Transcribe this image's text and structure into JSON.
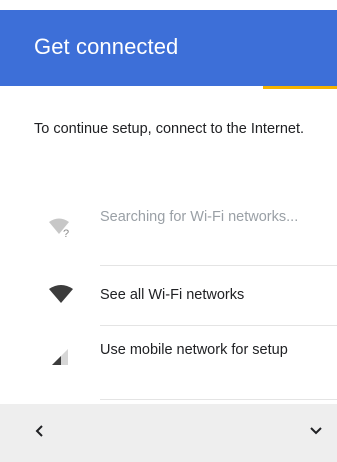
{
  "header": {
    "title": "Get connected"
  },
  "intro": {
    "text": "To continue setup, connect to the Internet."
  },
  "options": [
    {
      "label": "Searching for Wi-Fi networks...",
      "icon": "wifi-searching-icon",
      "state": "disabled"
    },
    {
      "label": "See all Wi-Fi networks",
      "icon": "wifi-icon",
      "state": "enabled"
    },
    {
      "label": "Use mobile network for setup",
      "icon": "cellular-signal-icon",
      "state": "enabled"
    }
  ],
  "nav": {
    "back_icon": "chevron-left-icon",
    "more_icon": "chevron-down-icon"
  },
  "colors": {
    "header": "#3d6fd8",
    "accent": "#f5b400",
    "nav_bar": "#eeeeee",
    "text": "#202124",
    "muted_text": "#9aa0a6",
    "icon_dark": "#3c3c3c",
    "icon_muted": "#bdbdbd"
  }
}
